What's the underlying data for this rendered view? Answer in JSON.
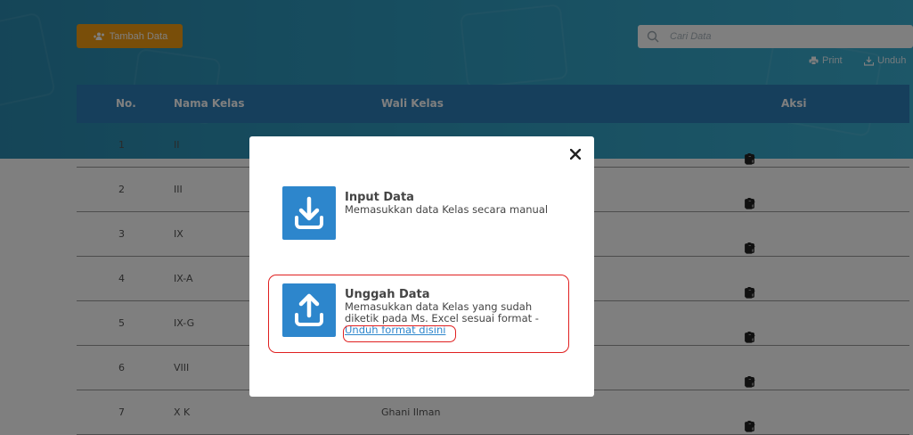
{
  "toolbar": {
    "add_label": "Tambah Data",
    "search_placeholder": "Cari Data",
    "print_label": "Print",
    "download_label": "Unduh"
  },
  "table": {
    "headers": {
      "no": "No.",
      "nama_kelas": "Nama Kelas",
      "wali_kelas": "Wali Kelas",
      "aksi": "Aksi"
    },
    "rows": [
      {
        "no": "1",
        "nama_kelas": "II",
        "wali_kelas": ""
      },
      {
        "no": "2",
        "nama_kelas": "III",
        "wali_kelas": ""
      },
      {
        "no": "3",
        "nama_kelas": "IX",
        "wali_kelas": ""
      },
      {
        "no": "4",
        "nama_kelas": "IX-A",
        "wali_kelas": ""
      },
      {
        "no": "5",
        "nama_kelas": "IX-G",
        "wali_kelas": ""
      },
      {
        "no": "6",
        "nama_kelas": "VIII",
        "wali_kelas": ""
      },
      {
        "no": "7",
        "nama_kelas": "X K",
        "wali_kelas": "Ghani Ilman"
      }
    ],
    "row_actions": [
      "eye-icon",
      "edit-icon",
      "trash-icon"
    ]
  },
  "modal": {
    "input": {
      "title": "Input Data",
      "description": "Memasukkan data Kelas secara manual"
    },
    "upload": {
      "title": "Unggah Data",
      "description": "Memasukkan data Kelas yang sudah diketik pada Ms. Excel sesuai format -",
      "link": "Unduh format disini"
    }
  },
  "colors": {
    "banner": "#2f9cc0",
    "header": "#2d7fb8",
    "add_button": "#f39c12",
    "tile": "#2d86cc",
    "highlight": "#e02020"
  }
}
